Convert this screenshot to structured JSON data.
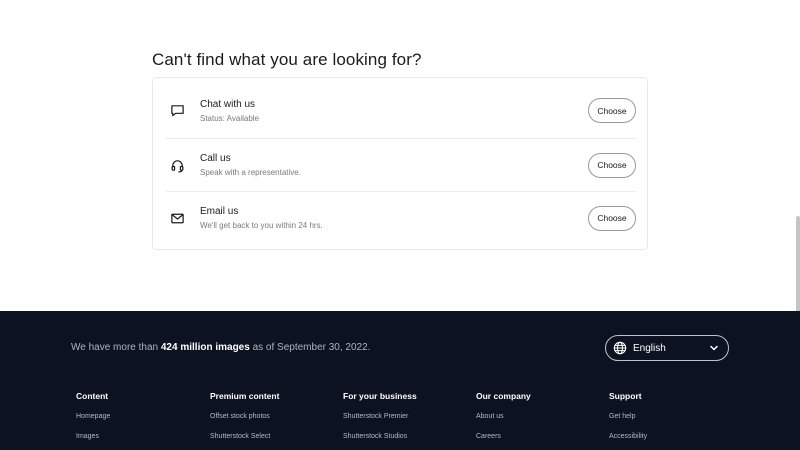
{
  "help": {
    "heading": "Can't find what you are looking for?",
    "options": [
      {
        "title": "Chat with us",
        "subtitle": "Status: Available",
        "button": "Choose",
        "icon": "chat-bubble-icon"
      },
      {
        "title": "Call us",
        "subtitle": "Speak with a representative.",
        "button": "Choose",
        "icon": "headset-icon"
      },
      {
        "title": "Email us",
        "subtitle": "We'll get back to you within 24 hrs.",
        "button": "Choose",
        "icon": "envelope-icon"
      }
    ]
  },
  "footer": {
    "stats_prefix": "We have more than ",
    "stats_highlight": "424 million images",
    "stats_suffix": " as of September 30, 2022.",
    "language": {
      "label": "English",
      "icon": "globe-icon",
      "chevron": "chevron-down-icon"
    },
    "columns": [
      {
        "heading": "Content",
        "links": [
          "Homepage",
          "Images"
        ]
      },
      {
        "heading": "Premium content",
        "links": [
          "Offset stock photos",
          "Shutterstock Select"
        ]
      },
      {
        "heading": "For your business",
        "links": [
          "Shutterstock Premier",
          "Shutterstock Studios"
        ]
      },
      {
        "heading": "Our company",
        "links": [
          "About us",
          "Careers"
        ]
      },
      {
        "heading": "Support",
        "links": [
          "Get help",
          "Accessibility"
        ]
      }
    ]
  },
  "colors": {
    "footer_bg": "#0c1221",
    "card_border": "#e8e8ea",
    "button_border": "#9a9aa0"
  }
}
